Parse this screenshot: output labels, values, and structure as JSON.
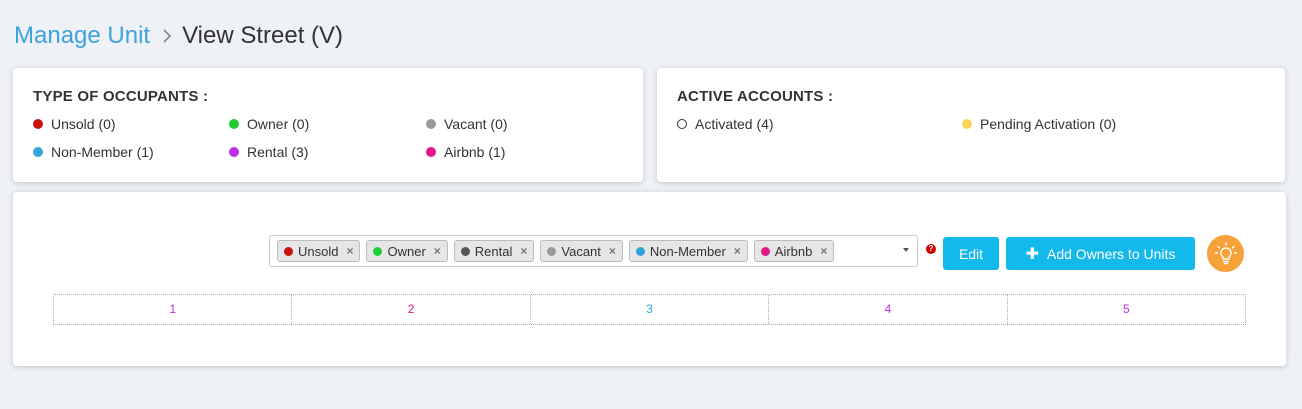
{
  "breadcrumb": {
    "parent": "Manage Unit",
    "current": "View Street (V)"
  },
  "occupants": {
    "title": "TYPE OF OCCUPANTS :",
    "items": [
      {
        "label": "Unsold (0)",
        "color": "#cc1111"
      },
      {
        "label": "Owner (0)",
        "color": "#22cc33"
      },
      {
        "label": "Vacant (0)",
        "color": "#999999"
      },
      {
        "label": "Non-Member (1)",
        "color": "#33a3dc"
      },
      {
        "label": "Rental (3)",
        "color": "#b82ee8"
      },
      {
        "label": "Airbnb (1)",
        "color": "#e0168a"
      }
    ]
  },
  "accounts": {
    "title": "ACTIVE ACCOUNTS :",
    "items": [
      {
        "label": "Activated (4)",
        "color": "#ffffff"
      },
      {
        "label": "Pending Activation (0)",
        "color": "#f8d65a"
      }
    ]
  },
  "filter": {
    "tags": [
      {
        "label": "Unsold",
        "color": "#cc1111"
      },
      {
        "label": "Owner",
        "color": "#22cc33"
      },
      {
        "label": "Rental",
        "color": "#555555"
      },
      {
        "label": "Vacant",
        "color": "#999999"
      },
      {
        "label": "Non-Member",
        "color": "#33a3dc"
      },
      {
        "label": "Airbnb",
        "color": "#e0168a"
      }
    ],
    "remove_glyph": "×",
    "help_glyph": "?"
  },
  "actions": {
    "edit_label": "Edit",
    "add_plus": "✚",
    "add_label": "Add Owners to Units"
  },
  "units": [
    {
      "label": "1",
      "color": "#b82ee8"
    },
    {
      "label": "2",
      "color": "#e0168a"
    },
    {
      "label": "3",
      "color": "#33a3dc"
    },
    {
      "label": "4",
      "color": "#b82ee8"
    },
    {
      "label": "5",
      "color": "#b82ee8"
    }
  ]
}
